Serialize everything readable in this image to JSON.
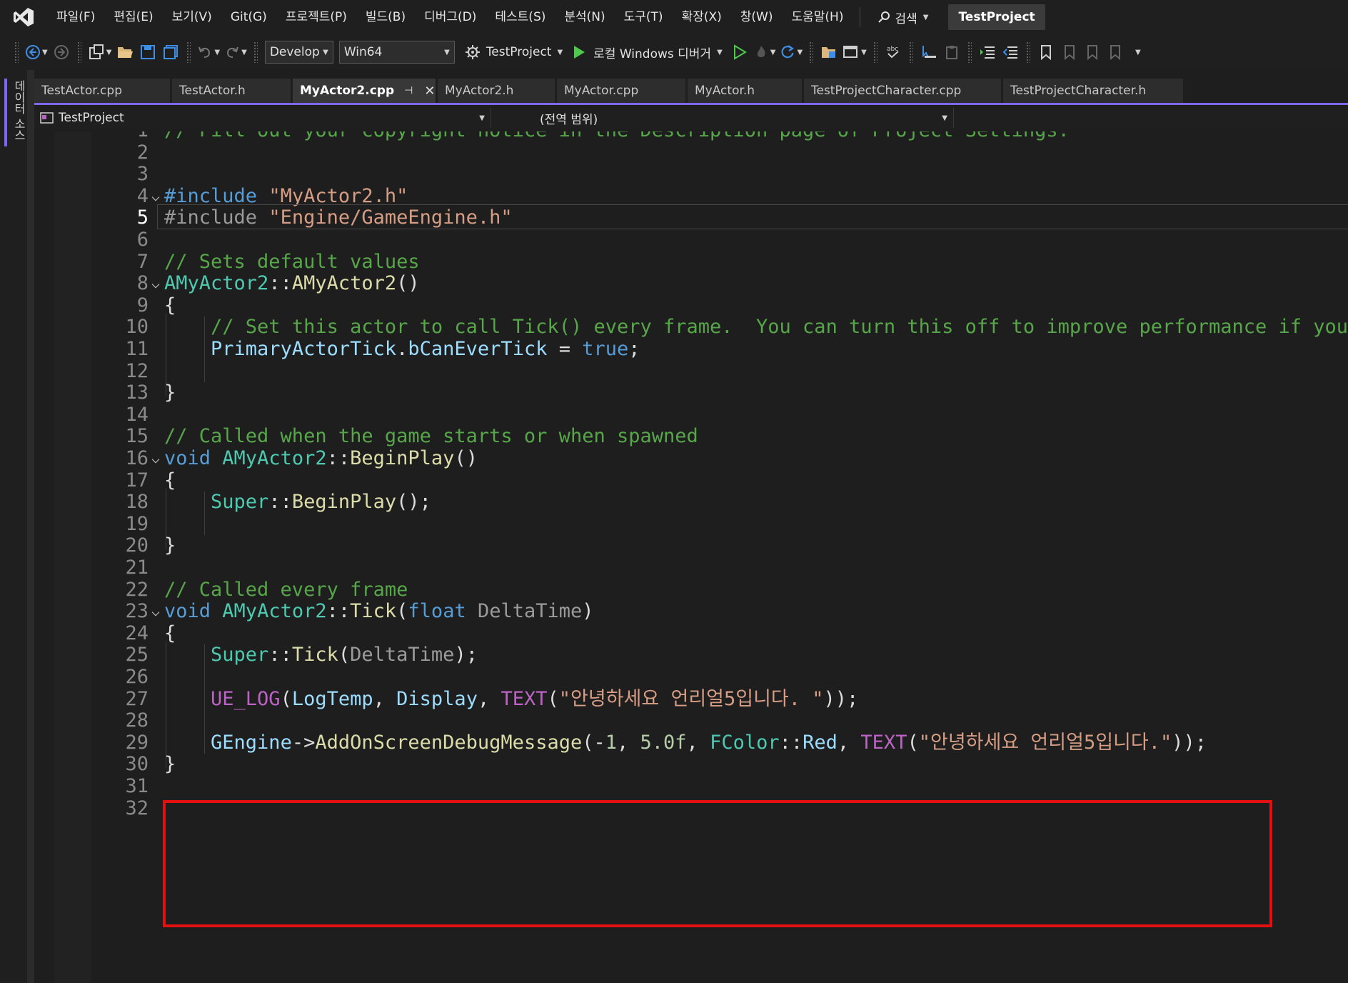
{
  "menubar": {
    "items": [
      "파일(F)",
      "편집(E)",
      "보기(V)",
      "Git(G)",
      "프로젝트(P)",
      "빌드(B)",
      "디버그(D)",
      "테스트(S)",
      "분석(N)",
      "도구(T)",
      "확장(X)",
      "창(W)",
      "도움말(H)"
    ],
    "search_label": "검색",
    "project_badge": "TestProject"
  },
  "toolbar": {
    "config_value": "Develop",
    "platform_value": "Win64",
    "startup_project": "TestProject",
    "debug_target": "로컬 Windows 디버거"
  },
  "side_panel": {
    "label": "데이터 소스"
  },
  "tabs": [
    {
      "label": "TestActor.cpp"
    },
    {
      "label": "TestActor.h"
    },
    {
      "label": "MyActor2.cpp"
    },
    {
      "label": "MyActor2.h"
    },
    {
      "label": "MyActor.cpp"
    },
    {
      "label": "MyActor.h"
    },
    {
      "label": "TestProjectCharacter.cpp"
    },
    {
      "label": "TestProjectCharacter.h"
    }
  ],
  "navbar": {
    "project": "TestProject",
    "scope": "(전역 범위)"
  },
  "editor": {
    "current_line": 5,
    "line_numbers": [
      "1",
      "2",
      "3",
      "4",
      "5",
      "6",
      "7",
      "8",
      "9",
      "10",
      "11",
      "12",
      "13",
      "14",
      "15",
      "16",
      "17",
      "18",
      "19",
      "20",
      "21",
      "22",
      "23",
      "24",
      "25",
      "26",
      "27",
      "28",
      "29",
      "30",
      "31",
      "32"
    ],
    "lines": [
      [
        [
          "c",
          "// Fill out your copyright notice in the Description page of Project Settings."
        ]
      ],
      [],
      [],
      [
        [
          "k",
          "#include"
        ],
        [
          "d",
          " "
        ],
        [
          "s",
          "\"MyActor2.h\""
        ]
      ],
      [
        [
          "a",
          "#include"
        ],
        [
          "d",
          " "
        ],
        [
          "s",
          "\"Engine/GameEngine.h\""
        ]
      ],
      [],
      [
        [
          "c",
          "// Sets default values"
        ]
      ],
      [
        [
          "t",
          "AMyActor2"
        ],
        [
          "d",
          "::"
        ],
        [
          "f",
          "AMyActor2"
        ],
        [
          "d",
          "()"
        ]
      ],
      [
        [
          "d",
          "{"
        ]
      ],
      [
        [
          "d",
          "    "
        ],
        [
          "c",
          "// Set this actor to call Tick() every frame.  You can turn this off to improve performance if you don't need it."
        ]
      ],
      [
        [
          "d",
          "    "
        ],
        [
          "v",
          "PrimaryActorTick"
        ],
        [
          "d",
          "."
        ],
        [
          "v",
          "bCanEverTick"
        ],
        [
          "d",
          " = "
        ],
        [
          "k",
          "true"
        ],
        [
          "d",
          ";"
        ]
      ],
      [],
      [
        [
          "d",
          "}"
        ]
      ],
      [],
      [
        [
          "c",
          "// Called when the game starts or when spawned"
        ]
      ],
      [
        [
          "k",
          "void"
        ],
        [
          "d",
          " "
        ],
        [
          "t",
          "AMyActor2"
        ],
        [
          "d",
          "::"
        ],
        [
          "f",
          "BeginPlay"
        ],
        [
          "d",
          "()"
        ]
      ],
      [
        [
          "d",
          "{"
        ]
      ],
      [
        [
          "d",
          "    "
        ],
        [
          "t",
          "Super"
        ],
        [
          "d",
          "::"
        ],
        [
          "f",
          "BeginPlay"
        ],
        [
          "d",
          "();"
        ]
      ],
      [],
      [
        [
          "d",
          "}"
        ]
      ],
      [],
      [
        [
          "c",
          "// Called every frame"
        ]
      ],
      [
        [
          "k",
          "void"
        ],
        [
          "d",
          " "
        ],
        [
          "t",
          "AMyActor2"
        ],
        [
          "d",
          "::"
        ],
        [
          "f",
          "Tick"
        ],
        [
          "d",
          "("
        ],
        [
          "k",
          "float"
        ],
        [
          "d",
          " "
        ],
        [
          "p",
          "DeltaTime"
        ],
        [
          "d",
          ")"
        ]
      ],
      [
        [
          "d",
          "{"
        ]
      ],
      [
        [
          "d",
          "    "
        ],
        [
          "t",
          "Super"
        ],
        [
          "d",
          "::"
        ],
        [
          "f",
          "Tick"
        ],
        [
          "d",
          "("
        ],
        [
          "p",
          "DeltaTime"
        ],
        [
          "d",
          ");"
        ]
      ],
      [],
      [
        [
          "d",
          "    "
        ],
        [
          "m",
          "UE_LOG"
        ],
        [
          "d",
          "("
        ],
        [
          "v",
          "LogTemp"
        ],
        [
          "d",
          ", "
        ],
        [
          "v",
          "Display"
        ],
        [
          "d",
          ", "
        ],
        [
          "m",
          "TEXT"
        ],
        [
          "d",
          "("
        ],
        [
          "s",
          "\"안녕하세요 언리얼5입니다. \""
        ],
        [
          "d",
          "));"
        ]
      ],
      [],
      [
        [
          "d",
          "    "
        ],
        [
          "v",
          "GEngine"
        ],
        [
          "d",
          "->"
        ],
        [
          "f",
          "AddOnScreenDebugMessage"
        ],
        [
          "d",
          "(-"
        ],
        [
          "n",
          "1"
        ],
        [
          "d",
          ", "
        ],
        [
          "n",
          "5.0f"
        ],
        [
          "d",
          ", "
        ],
        [
          "t",
          "FColor"
        ],
        [
          "d",
          "::"
        ],
        [
          "v",
          "Red"
        ],
        [
          "d",
          ", "
        ],
        [
          "m",
          "TEXT"
        ],
        [
          "d",
          "("
        ],
        [
          "s",
          "\"안녕하세요 언리얼5입니다.\""
        ],
        [
          "d",
          "));"
        ]
      ],
      [
        [
          "d",
          "}"
        ]
      ],
      [],
      []
    ]
  }
}
